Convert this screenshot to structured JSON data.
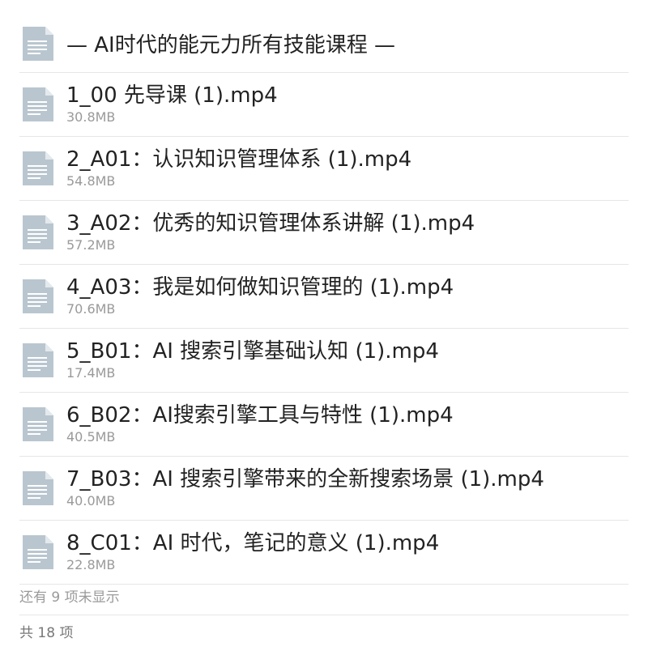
{
  "folder": {
    "title": "— AI时代的能元力所有技能课程 —",
    "icon": "document-icon"
  },
  "files": [
    {
      "name": "1_00 先导课 (1).mp4",
      "size": "30.8MB",
      "icon": "document-icon"
    },
    {
      "name": "2_A01：认识知识管理体系 (1).mp4",
      "size": "54.8MB",
      "icon": "document-icon"
    },
    {
      "name": "3_A02：优秀的知识管理体系讲解 (1).mp4",
      "size": "57.2MB",
      "icon": "document-icon"
    },
    {
      "name": "4_A03：我是如何做知识管理的 (1).mp4",
      "size": "70.6MB",
      "icon": "document-icon"
    },
    {
      "name": "5_B01：AI 搜索引擎基础认知 (1).mp4",
      "size": "17.4MB",
      "icon": "document-icon"
    },
    {
      "name": "6_B02：AI搜索引擎工具与特性 (1).mp4",
      "size": "40.5MB",
      "icon": "document-icon"
    },
    {
      "name": "7_B03：AI 搜索引擎带来的全新搜索场景 (1).mp4",
      "size": "40.0MB",
      "icon": "document-icon"
    },
    {
      "name": "8_C01：AI 时代，笔记的意义 (1).mp4",
      "size": "22.8MB",
      "icon": "document-icon"
    }
  ],
  "hidden_note": "还有 9 项未显示",
  "total": "共 18 项",
  "colors": {
    "icon_fill": "#b9c6cf",
    "icon_fold": "#e3e9ed",
    "icon_lines": "#ffffff",
    "divider": "#e6e6e6",
    "secondary_text": "#9a9a9a"
  }
}
